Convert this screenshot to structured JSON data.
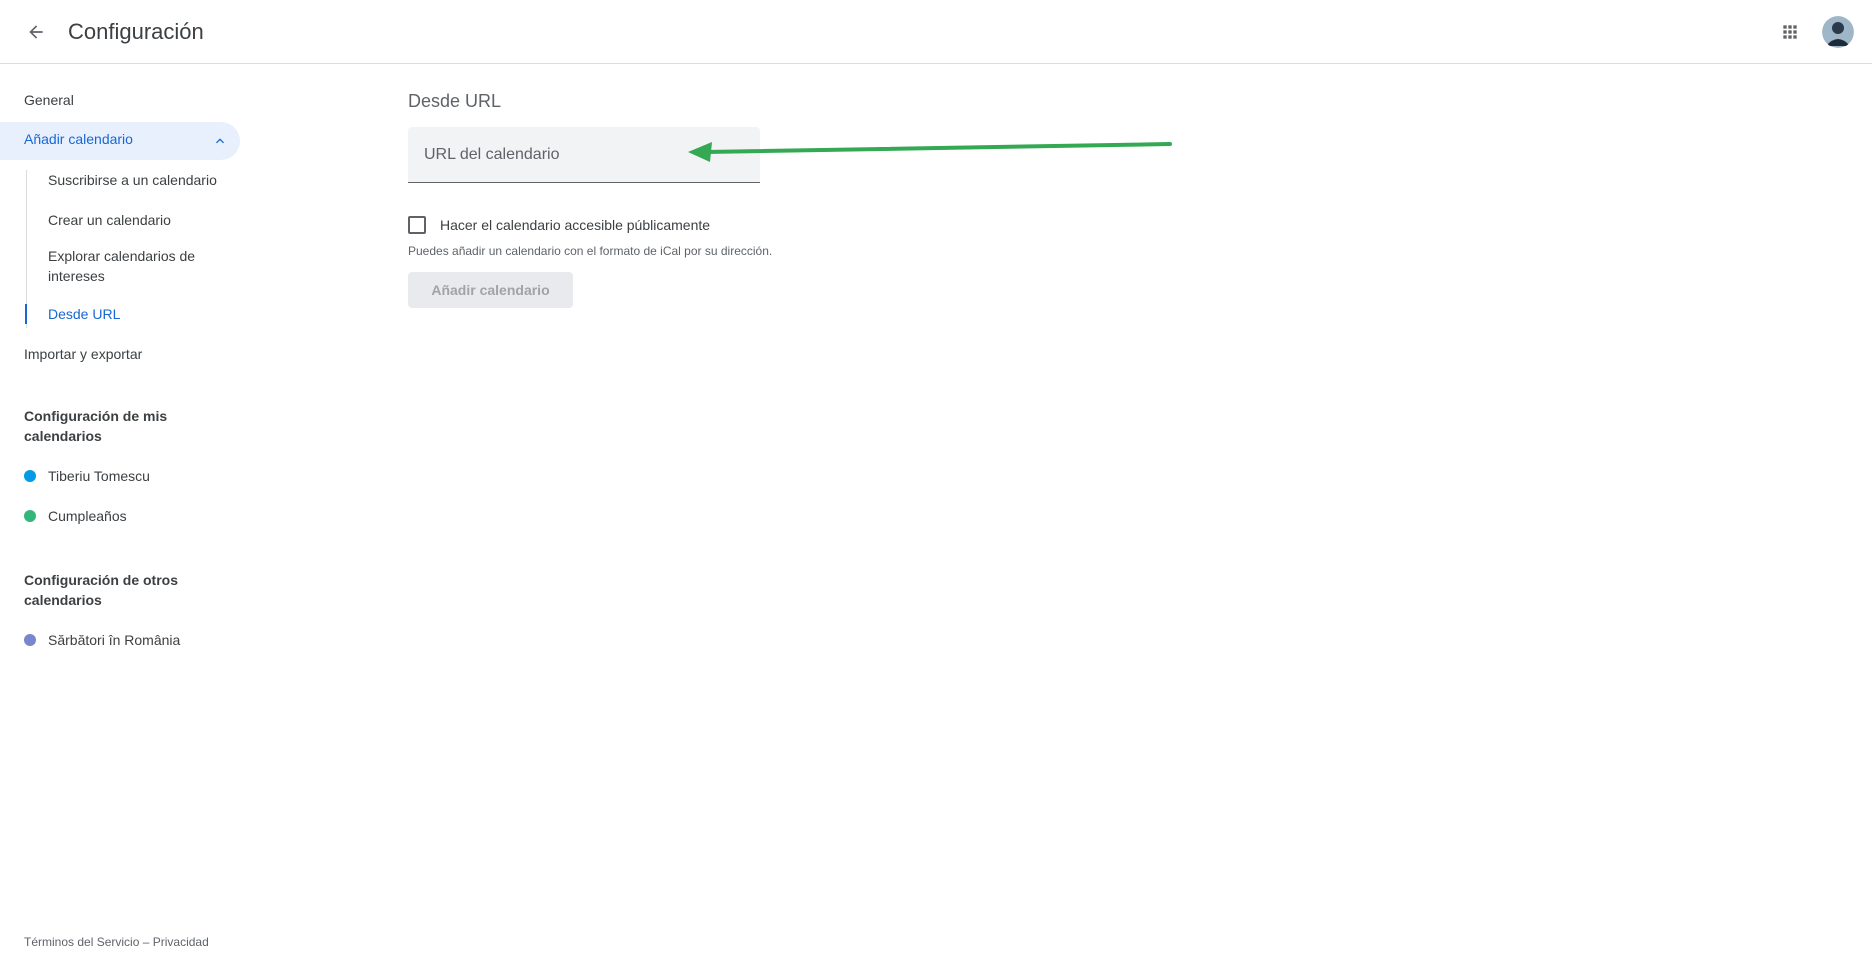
{
  "header": {
    "title": "Configuración",
    "back_icon": "arrow-back-icon",
    "apps_icon": "apps-grid-icon"
  },
  "sidebar": {
    "general": "General",
    "add_calendar": "Añadir calendario",
    "sub_items": [
      "Suscribirse a un calendario",
      "Crear un calendario",
      "Explorar calendarios de intereses",
      "Desde URL"
    ],
    "import_export": "Importar y exportar",
    "my_calendars_title": "Configuración de mis calendarios",
    "my_calendars": [
      {
        "name": "Tiberiu Tomescu",
        "color": "#039be5"
      },
      {
        "name": "Cumpleaños",
        "color": "#33b679"
      }
    ],
    "other_calendars_title": "Configuración de otros calendarios",
    "other_calendars": [
      {
        "name": "Sărbători în România",
        "color": "#7986cb"
      }
    ]
  },
  "main": {
    "section_title": "Desde URL",
    "url_placeholder": "URL del calendario",
    "url_value": "",
    "public_checkbox_label": "Hacer el calendario accesible públicamente",
    "public_checked": false,
    "helper_text": "Puedes añadir un calendario con el formato de iCal por su dirección.",
    "add_button": "Añadir calendario"
  },
  "footer": {
    "terms": "Términos del Servicio",
    "separator": "–",
    "privacy": "Privacidad"
  },
  "colors": {
    "accent": "#1967d2",
    "annotation_arrow": "#34a853"
  }
}
